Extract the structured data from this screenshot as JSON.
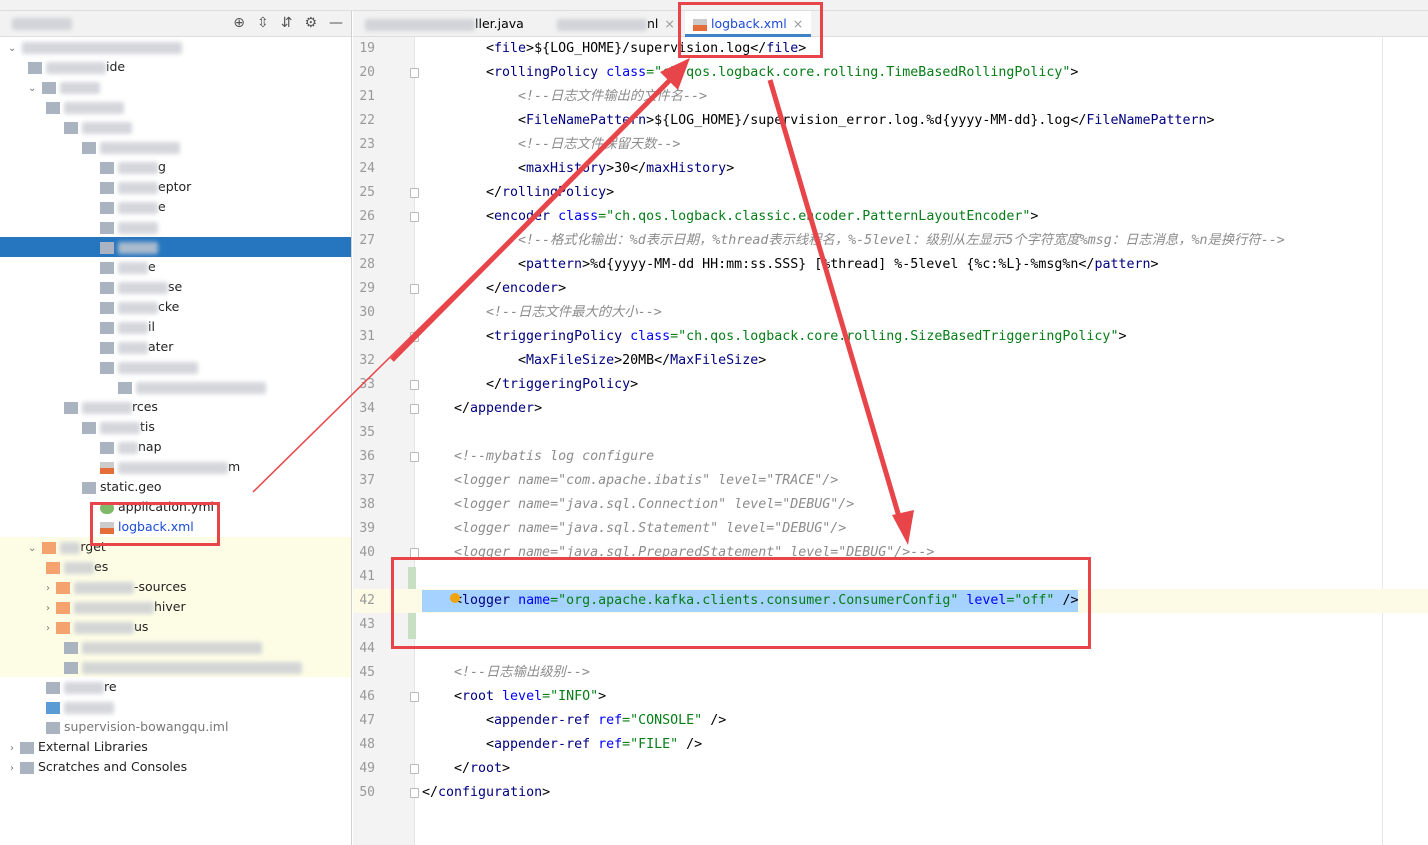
{
  "sidebar": {
    "header_tools": [
      "⊕",
      "⇳",
      "⇵",
      "⚙",
      "—"
    ],
    "rows": [
      {
        "text": "ide",
        "depth": 1,
        "chev": "",
        "icon": "folder",
        "blur": 60,
        "style": ""
      },
      {
        "text": "",
        "depth": 1,
        "chev": "⌄",
        "icon": "folder",
        "blur": 40,
        "style": ""
      },
      {
        "text": "",
        "depth": 2,
        "chev": "",
        "icon": "folder",
        "blur": 60,
        "style": ""
      },
      {
        "text": "",
        "depth": 3,
        "chev": "",
        "icon": "folder",
        "blur": 50,
        "style": ""
      },
      {
        "text": "",
        "depth": 4,
        "chev": "",
        "icon": "folder",
        "blur": 80,
        "style": ""
      },
      {
        "text": "g",
        "depth": 5,
        "chev": "",
        "icon": "folder",
        "blur": 40,
        "style": ""
      },
      {
        "text": "eptor",
        "depth": 5,
        "chev": "",
        "icon": "folder",
        "blur": 40,
        "style": ""
      },
      {
        "text": "e",
        "depth": 5,
        "chev": "",
        "icon": "folder",
        "blur": 40,
        "style": ""
      },
      {
        "text": "",
        "depth": 5,
        "chev": "",
        "icon": "folder",
        "blur": 40,
        "style": ""
      },
      {
        "text": "",
        "depth": 5,
        "chev": "",
        "icon": "folder",
        "blur": 40,
        "style": "sel"
      },
      {
        "text": "e",
        "depth": 5,
        "chev": "",
        "icon": "folder",
        "blur": 30,
        "style": ""
      },
      {
        "text": "se",
        "depth": 5,
        "chev": "",
        "icon": "folder",
        "blur": 50,
        "style": ""
      },
      {
        "text": "cke",
        "depth": 5,
        "chev": "",
        "icon": "folder",
        "blur": 40,
        "style": ""
      },
      {
        "text": "il",
        "depth": 5,
        "chev": "",
        "icon": "folder",
        "blur": 30,
        "style": ""
      },
      {
        "text": "ater",
        "depth": 5,
        "chev": "",
        "icon": "folder",
        "blur": 30,
        "style": ""
      },
      {
        "text": "",
        "depth": 5,
        "chev": "",
        "icon": "folder",
        "blur": 80,
        "style": ""
      },
      {
        "text": "",
        "depth": 6,
        "chev": "",
        "icon": "folder",
        "blur": 130,
        "style": ""
      },
      {
        "text": "rces",
        "depth": 3,
        "chev": "",
        "icon": "folder",
        "blur": 50,
        "style": ""
      },
      {
        "text": "tis",
        "depth": 4,
        "chev": "",
        "icon": "folder",
        "blur": 40,
        "style": ""
      },
      {
        "text": "nap",
        "depth": 5,
        "chev": "",
        "icon": "folder",
        "blur": 20,
        "style": ""
      },
      {
        "text": "m",
        "depth": 5,
        "chev": "",
        "icon": "xml",
        "blur": 110,
        "style": ""
      },
      {
        "text": "static.geo",
        "depth": 4,
        "chev": "",
        "icon": "folder",
        "blur": 0,
        "style": ""
      },
      {
        "text": "application.yml",
        "depth": 5,
        "chev": "",
        "icon": "yml",
        "blur": 0,
        "style": ""
      },
      {
        "text": "logback.xml",
        "depth": 5,
        "chev": "",
        "icon": "xml",
        "blur": 0,
        "style": "blue"
      },
      {
        "text": "rget",
        "depth": 1,
        "chev": "⌄",
        "icon": "ofolder",
        "blur": 20,
        "style": "tgt"
      },
      {
        "text": "es",
        "depth": 2,
        "chev": "",
        "icon": "ofolder",
        "blur": 30,
        "style": "tgt"
      },
      {
        "text": "-sources",
        "depth": 2,
        "chev": "›",
        "icon": "ofolder",
        "blur": 60,
        "style": "tgt"
      },
      {
        "text": "hiver",
        "depth": 2,
        "chev": "›",
        "icon": "ofolder",
        "blur": 80,
        "style": "tgt"
      },
      {
        "text": "us",
        "depth": 2,
        "chev": "›",
        "icon": "ofolder",
        "blur": 60,
        "style": "tgt"
      },
      {
        "text": "",
        "depth": 3,
        "chev": "",
        "icon": "folder",
        "blur": 180,
        "style": "tgt"
      },
      {
        "text": "",
        "depth": 3,
        "chev": "",
        "icon": "folder",
        "blur": 220,
        "style": "tgt"
      },
      {
        "text": "re",
        "depth": 2,
        "chev": "",
        "icon": "folder",
        "blur": 40,
        "style": ""
      },
      {
        "text": "",
        "depth": 2,
        "chev": "",
        "icon": "maven",
        "blur": 50,
        "style": ""
      },
      {
        "text": "supervision-bowangqu.iml",
        "depth": 2,
        "chev": "",
        "icon": "folder",
        "blur": 0,
        "style": "gray"
      },
      {
        "text": "External Libraries",
        "depth": 0,
        "chev": "›",
        "icon": "lib",
        "blur": 0,
        "style": ""
      },
      {
        "text": "Scratches and Consoles",
        "depth": 0,
        "chev": "›",
        "icon": "scratch",
        "blur": 0,
        "style": ""
      }
    ]
  },
  "tabs": [
    {
      "label": "ller.java",
      "close": ""
    },
    {
      "label": "nl",
      "close": "×"
    },
    {
      "label": "logback.xml",
      "close": "×",
      "active": true
    }
  ],
  "editor": {
    "first_line": 19,
    "current_line": 42,
    "lines": [
      {
        "i": 2,
        "s": [
          [
            "p",
            "<"
          ],
          [
            "t",
            "file"
          ],
          [
            "p",
            ">"
          ],
          [
            "x",
            "${LOG_HOME}/supervision.log"
          ],
          [
            "p",
            "</"
          ],
          [
            "t",
            "file"
          ],
          [
            "p",
            ">"
          ]
        ]
      },
      {
        "i": 2,
        "s": [
          [
            "p",
            "<"
          ],
          [
            "t",
            "rollingPolicy "
          ],
          [
            "a",
            "class"
          ],
          [
            "v",
            "=\"ch.qos.logback.core.rolling.TimeBasedRollingPolicy\""
          ],
          [
            "p",
            ">"
          ]
        ]
      },
      {
        "i": 3,
        "s": [
          [
            "c",
            "<!--日志文件输出的文件名-->"
          ]
        ]
      },
      {
        "i": 3,
        "s": [
          [
            "p",
            "<"
          ],
          [
            "t",
            "FileNamePattern"
          ],
          [
            "p",
            ">"
          ],
          [
            "x",
            "${LOG_HOME}/supervision_error.log.%d{yyyy-MM-dd}.log"
          ],
          [
            "p",
            "</"
          ],
          [
            "t",
            "FileNamePattern"
          ],
          [
            "p",
            ">"
          ]
        ]
      },
      {
        "i": 3,
        "s": [
          [
            "c",
            "<!--日志文件保留天数-->"
          ]
        ]
      },
      {
        "i": 3,
        "s": [
          [
            "p",
            "<"
          ],
          [
            "t",
            "maxHistory"
          ],
          [
            "p",
            ">"
          ],
          [
            "x",
            "30"
          ],
          [
            "p",
            "</"
          ],
          [
            "t",
            "maxHistory"
          ],
          [
            "p",
            ">"
          ]
        ]
      },
      {
        "i": 2,
        "s": [
          [
            "p",
            "</"
          ],
          [
            "t",
            "rollingPolicy"
          ],
          [
            "p",
            ">"
          ]
        ]
      },
      {
        "i": 2,
        "s": [
          [
            "p",
            "<"
          ],
          [
            "t",
            "encoder "
          ],
          [
            "a",
            "class"
          ],
          [
            "v",
            "=\"ch.qos.logback.classic.encoder.PatternLayoutEncoder\""
          ],
          [
            "p",
            ">"
          ]
        ]
      },
      {
        "i": 3,
        "s": [
          [
            "c",
            "<!--格式化输出：%d表示日期，%thread表示线程名，%-5level：级别从左显示5个字符宽度%msg：日志消息，%n是换行符-->"
          ]
        ]
      },
      {
        "i": 3,
        "s": [
          [
            "p",
            "<"
          ],
          [
            "t",
            "pattern"
          ],
          [
            "p",
            ">"
          ],
          [
            "x",
            "%d{yyyy-MM-dd HH:mm:ss.SSS} [%thread] %-5level {%c:%L}-%msg%n"
          ],
          [
            "p",
            "</"
          ],
          [
            "t",
            "pattern"
          ],
          [
            "p",
            ">"
          ]
        ]
      },
      {
        "i": 2,
        "s": [
          [
            "p",
            "</"
          ],
          [
            "t",
            "encoder"
          ],
          [
            "p",
            ">"
          ]
        ]
      },
      {
        "i": 2,
        "s": [
          [
            "c",
            "<!--日志文件最大的大小-->"
          ]
        ]
      },
      {
        "i": 2,
        "s": [
          [
            "p",
            "<"
          ],
          [
            "t",
            "triggeringPolicy "
          ],
          [
            "a",
            "class"
          ],
          [
            "v",
            "=\"ch.qos.logback.core.rolling.SizeBasedTriggeringPolicy\""
          ],
          [
            "p",
            ">"
          ]
        ]
      },
      {
        "i": 3,
        "s": [
          [
            "p",
            "<"
          ],
          [
            "t",
            "MaxFileSize"
          ],
          [
            "p",
            ">"
          ],
          [
            "x",
            "20MB"
          ],
          [
            "p",
            "</"
          ],
          [
            "t",
            "MaxFileSize"
          ],
          [
            "p",
            ">"
          ]
        ]
      },
      {
        "i": 2,
        "s": [
          [
            "p",
            "</"
          ],
          [
            "t",
            "triggeringPolicy"
          ],
          [
            "p",
            ">"
          ]
        ]
      },
      {
        "i": 1,
        "s": [
          [
            "p",
            "</"
          ],
          [
            "t",
            "appender"
          ],
          [
            "p",
            ">"
          ]
        ]
      },
      {
        "i": 0,
        "s": []
      },
      {
        "i": 1,
        "s": [
          [
            "c",
            "<!--mybatis log configure"
          ]
        ]
      },
      {
        "i": 1,
        "s": [
          [
            "c",
            "<logger name=\"com.apache.ibatis\" level=\"TRACE\"/>"
          ]
        ]
      },
      {
        "i": 1,
        "s": [
          [
            "c",
            "<logger name=\"java.sql.Connection\" level=\"DEBUG\"/>"
          ]
        ]
      },
      {
        "i": 1,
        "s": [
          [
            "c",
            "<logger name=\"java.sql.Statement\" level=\"DEBUG\"/>"
          ]
        ]
      },
      {
        "i": 1,
        "s": [
          [
            "c",
            "<logger name=\"java.sql.PreparedStatement\" level=\"DEBUG\"/>-->"
          ]
        ]
      },
      {
        "i": 0,
        "s": []
      },
      {
        "i": 1,
        "s": [
          [
            "p",
            "<"
          ],
          [
            "t",
            "logger "
          ],
          [
            "a",
            "name"
          ],
          [
            "v",
            "=\"org.apache.kafka.clients.consumer.ConsumerConfig\" "
          ],
          [
            "a",
            "level"
          ],
          [
            "v",
            "=\"off\" "
          ],
          [
            "p",
            "/>"
          ]
        ]
      },
      {
        "i": 0,
        "s": []
      },
      {
        "i": 0,
        "s": []
      },
      {
        "i": 1,
        "s": [
          [
            "c",
            "<!--日志输出级别-->"
          ]
        ]
      },
      {
        "i": 1,
        "s": [
          [
            "p",
            "<"
          ],
          [
            "t",
            "root "
          ],
          [
            "a",
            "level"
          ],
          [
            "v",
            "=\"INFO\""
          ],
          [
            "p",
            ">"
          ]
        ]
      },
      {
        "i": 2,
        "s": [
          [
            "p",
            "<"
          ],
          [
            "t",
            "appender-ref "
          ],
          [
            "a",
            "ref"
          ],
          [
            "v",
            "=\"CONSOLE\" "
          ],
          [
            "p",
            "/>"
          ]
        ]
      },
      {
        "i": 2,
        "s": [
          [
            "p",
            "<"
          ],
          [
            "t",
            "appender-ref "
          ],
          [
            "a",
            "ref"
          ],
          [
            "v",
            "=\"FILE\" "
          ],
          [
            "p",
            "/>"
          ]
        ]
      },
      {
        "i": 1,
        "s": [
          [
            "p",
            "</"
          ],
          [
            "t",
            "root"
          ],
          [
            "p",
            ">"
          ]
        ]
      },
      {
        "i": 0,
        "s": [
          [
            "p",
            "</"
          ],
          [
            "t",
            "configuration"
          ],
          [
            "p",
            ">"
          ]
        ]
      }
    ]
  },
  "colors": {
    "annotation": "#e8454a",
    "selection": "#a6d2ff",
    "selected_row": "#2675bf"
  }
}
